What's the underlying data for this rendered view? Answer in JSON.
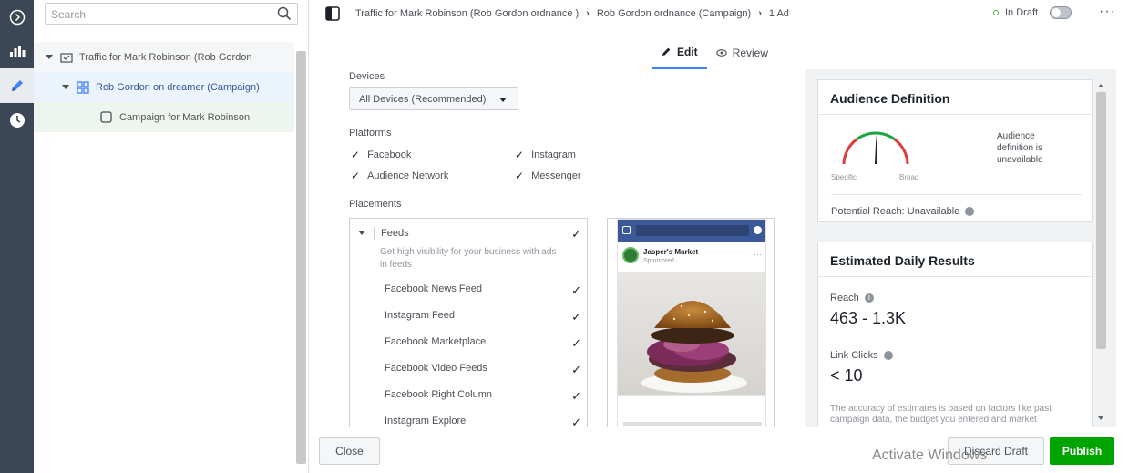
{
  "colors": {
    "accent": "#4080ff",
    "primary_green": "#00a400",
    "rail_bg": "#3c4755",
    "link_blue": "#365899"
  },
  "search": {
    "placeholder": "Search"
  },
  "tree": {
    "campaign_label": "Traffic for Mark Robinson (Rob Gordon",
    "adset_label": "Rob Gordon on dreamer (Campaign)",
    "ad_label": "Campaign for Mark Robinson"
  },
  "topbar": {
    "crumb_campaign": "Traffic for Mark Robinson (Rob Gordon ordnance )",
    "crumb_adset": "Rob Gordon ordnance (Campaign)",
    "crumb_ads": "1 Ad",
    "status": "In Draft",
    "more": "···"
  },
  "tabs": {
    "edit": "Edit",
    "review": "Review"
  },
  "form": {
    "devices_label": "Devices",
    "devices_value": "All Devices (Recommended)",
    "platforms_label": "Platforms",
    "platforms": [
      "Facebook",
      "Instagram",
      "Audience Network",
      "Messenger"
    ],
    "placements_label": "Placements",
    "feeds_header": "Feeds",
    "feeds_desc": "Get high visibility for your business with ads in feeds",
    "placements": [
      "Facebook News Feed",
      "Instagram Feed",
      "Facebook Marketplace",
      "Facebook Video Feeds",
      "Facebook Right Column",
      "Instagram Explore"
    ]
  },
  "preview": {
    "account_name": "Jasper's Market",
    "account_sub": "Sponsored ·"
  },
  "audience": {
    "title": "Audience Definition",
    "gauge_left": "Specific",
    "gauge_right": "Broad",
    "side_text": "Audience definition is unavailable",
    "reach_text": "Potential Reach: Unavailable"
  },
  "results": {
    "title": "Estimated Daily Results",
    "reach_label": "Reach",
    "reach_value": "463 - 1.3K",
    "clicks_label": "Link Clicks",
    "clicks_value": "< 10",
    "note": "The accuracy of estimates is based on factors like past campaign data, the budget you entered and market"
  },
  "footer": {
    "close": "Close",
    "discard": "Discard Draft",
    "publish": "Publish",
    "watermark": "Activate Windows"
  }
}
